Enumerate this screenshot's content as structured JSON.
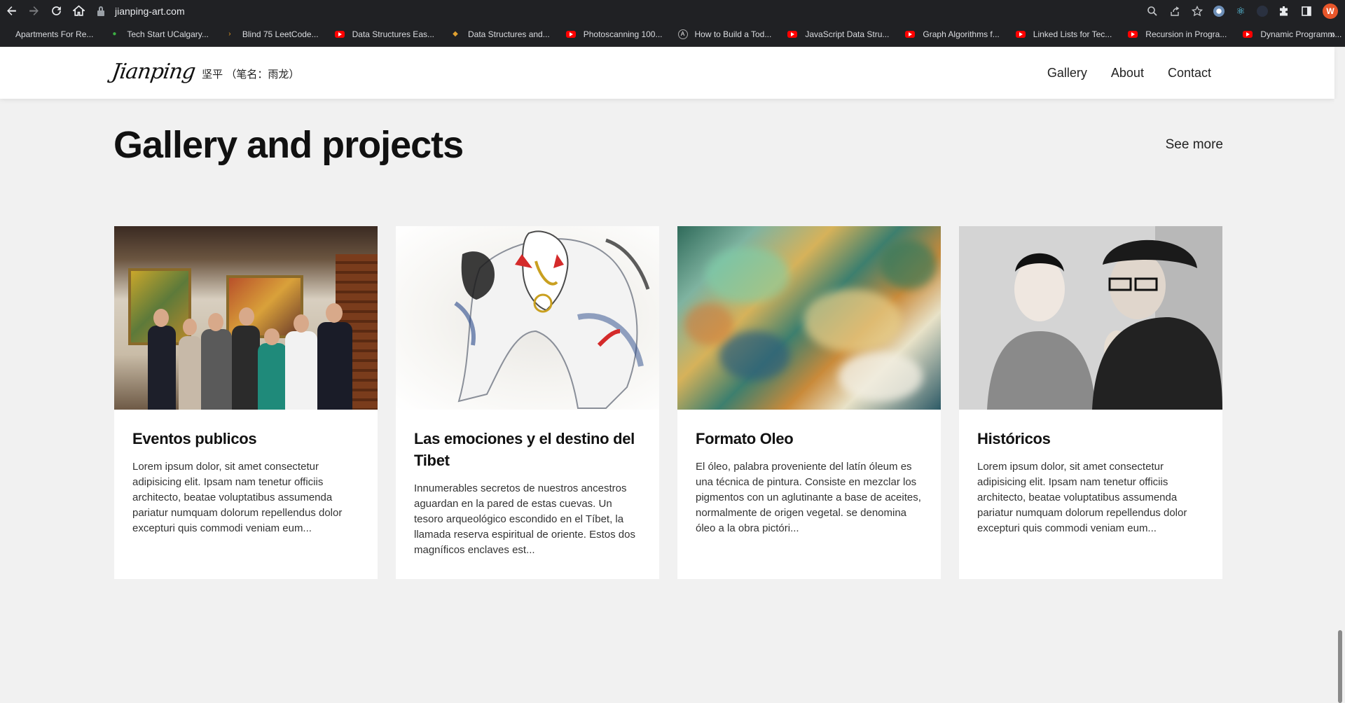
{
  "browser": {
    "url": "jianping-art.com",
    "bookmarks": [
      {
        "label": "Apartments For Re...",
        "icon": "none"
      },
      {
        "label": "Tech Start UCalgary...",
        "icon": "green-leaf-icon"
      },
      {
        "label": "Blind 75 LeetCode...",
        "icon": "leetcode-icon"
      },
      {
        "label": "Data Structures Eas...",
        "icon": "youtube-icon"
      },
      {
        "label": "Data Structures and...",
        "icon": "shield-icon"
      },
      {
        "label": "Photoscanning 100...",
        "icon": "youtube-icon"
      },
      {
        "label": "How to Build a Tod...",
        "icon": "a-icon"
      },
      {
        "label": "JavaScript Data Stru...",
        "icon": "youtube-icon"
      },
      {
        "label": "Graph Algorithms f...",
        "icon": "youtube-icon"
      },
      {
        "label": "Linked Lists for Tec...",
        "icon": "youtube-icon"
      },
      {
        "label": "Recursion in Progra...",
        "icon": "youtube-icon"
      },
      {
        "label": "Dynamic Programm...",
        "icon": "youtube-icon"
      }
    ],
    "more": "»",
    "avatar_letter": "W"
  },
  "site": {
    "logo_script": "Jianping",
    "logo_cn": "坚平 （笔名：雨龙）",
    "nav": [
      "Gallery",
      "About",
      "Contact"
    ]
  },
  "section": {
    "title": "Gallery and projects",
    "see_more": "See more"
  },
  "cards": [
    {
      "title": "Eventos publicos",
      "text": "Lorem ipsum dolor, sit amet consectetur adipisicing elit. Ipsam nam tenetur officiis architecto, beatae voluptatibus assumenda pariatur numquam dolorum repellendus dolor excepturi quis commodi veniam eum...",
      "image": "public-event-photo"
    },
    {
      "title": "Las emociones y el destino del Tibet",
      "text": "Innumerables secretos de nuestros ancestros aguardan en la pared de estas cuevas. Un tesoro arqueológico escondido en el Tíbet, la llamada reserva espiritual de oriente. Estos dos magníficos enclaves est...",
      "image": "horse-ink-painting"
    },
    {
      "title": "Formato Oleo",
      "text": "El óleo, palabra proveniente del latín óleum es una técnica de pintura. Consiste en mezclar los pigmentos con un aglutinante a base de aceites, normalmente de origen vegetal. se denomina óleo a la obra pictóri...",
      "image": "abstract-oil-painting"
    },
    {
      "title": "Históricos",
      "text": "Lorem ipsum dolor, sit amet consectetur adipisicing elit. Ipsam nam tenetur officiis architecto, beatae voluptatibus assumenda pariatur numquam dolorum repellendus dolor excepturi quis commodi veniam eum...",
      "image": "historic-bw-photo"
    }
  ]
}
